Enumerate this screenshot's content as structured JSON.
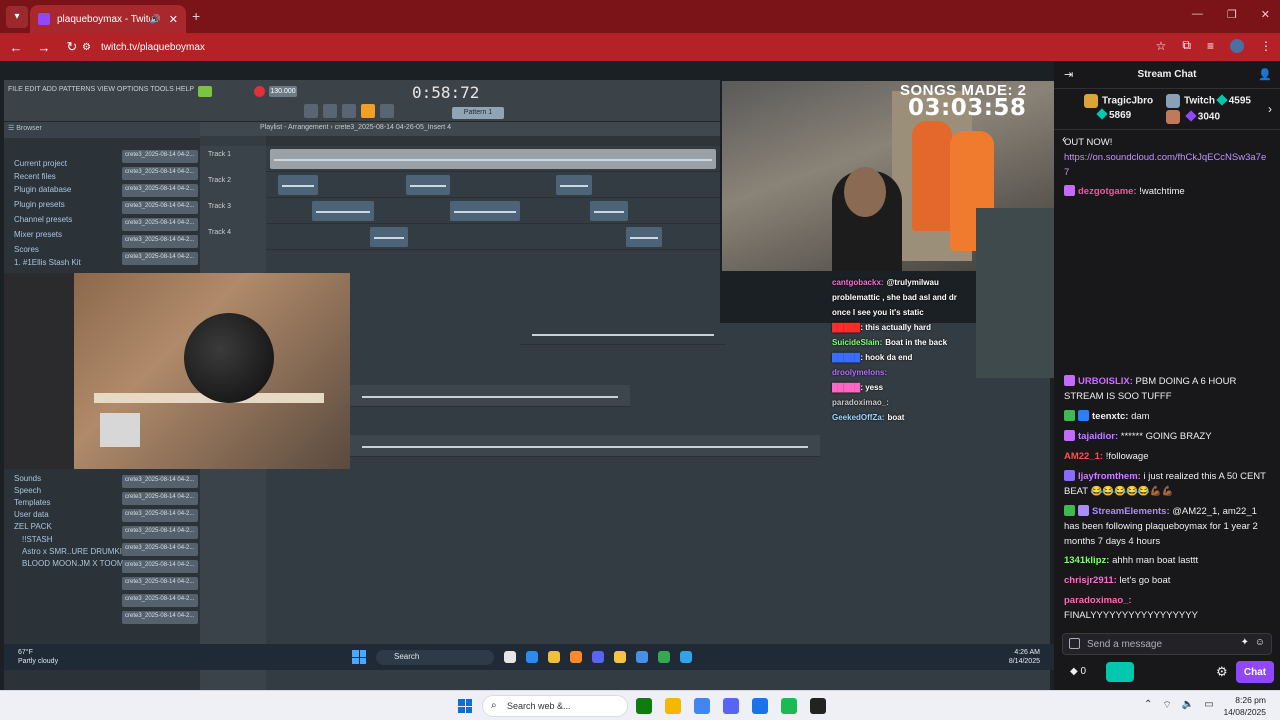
{
  "browser": {
    "tab_title": "plaqueboymax - Twitch",
    "new_tab": "+",
    "url": "twitch.tv/plaqueboymax"
  },
  "stream": {
    "songs_made": "SONGS MADE: 2",
    "timer": "03:03:58",
    "fl_menu": "FILE EDIT ADD PATTERNS VIEW OPTIONS TOOLS HELP",
    "fl_time": "0:58:72",
    "fl_bpm": "130.000",
    "fl_pattern": "Pattern 1",
    "playlist_title": "Playlist - Arrangement",
    "playlist_file": "crete3_2025-08-14 04-26-05_Insert 4",
    "tracks": [
      "Track 1",
      "Track 2",
      "Track 3",
      "Track 4"
    ],
    "browser_items": [
      "Current project",
      "Recent files",
      "Plugin database",
      "Plugin presets",
      "Channel presets",
      "Mixer presets",
      "Scores",
      "1. #1Ellis Stash Kit"
    ],
    "browser_items_lower": [
      "Sounds",
      "Speech",
      "Templates",
      "User data",
      "ZEL PACK",
      "!!STASH",
      "Astro x SMR..URE DRUMKIT",
      "BLOOD MOON.JM X TOOM"
    ],
    "file_entry": "crete3_2025-08-14 04-2...",
    "weather_temp": "67°F",
    "weather_desc": "Partly cloudy",
    "inner_search": "Search",
    "inner_time": "4:26 AM",
    "inner_date": "8/14/2025",
    "overlay_chat": [
      {
        "user": "cantgobackx:",
        "text": "@trulymilwau",
        "color": "#ff6ad5"
      },
      {
        "user": "",
        "text": "problemattic , she bad asl and dr",
        "color": "#fff"
      },
      {
        "user": "",
        "text": "once I see you it's static",
        "color": "#fff"
      },
      {
        "user": "",
        "text": ": this actually hard",
        "color": "#ff2b2b"
      },
      {
        "user": "SuicideSlain:",
        "text": "Boat in the back",
        "color": "#7cff7c"
      },
      {
        "user": "",
        "text": ": hook da end",
        "color": "#3b6bff"
      },
      {
        "user": "droolymelons:",
        "text": "",
        "color": "#b86bff"
      },
      {
        "user": "",
        "text": ": yess",
        "color": "#ff66c4"
      },
      {
        "user": "paradoximao_:",
        "text": "",
        "color": "#c8c8c8"
      },
      {
        "user": "GeekedOffZa:",
        "text": "boat",
        "color": "#9ad6ff"
      }
    ]
  },
  "chat": {
    "title": "Stream Chat",
    "gifts": [
      {
        "name": "TragicJbro",
        "count": "5869"
      },
      {
        "name": "Twitch",
        "count": "4595"
      },
      {
        "name": "",
        "count": "3040"
      }
    ],
    "messages": [
      {
        "user": "",
        "text": "OUT NOW!",
        "color": "#efeff1"
      },
      {
        "user": "",
        "link": "https://on.soundcloud.com/fhCkJqECcNSw3a7e7",
        "color": "#bf94ff"
      },
      {
        "user": "dezgotgame:",
        "text": "!watchtime",
        "color": "#ff4f9a"
      },
      {
        "user": "URBOISLIX:",
        "text": "PBM DOING A 6 HOUR STREAM IS SOO TUFFF",
        "color": "#d36bff"
      },
      {
        "user": "teenxtc:",
        "text": "dam",
        "color": "#efeff1"
      },
      {
        "user": "tajaidior:",
        "text": "****** GOING BRAZY",
        "color": "#c77dff"
      },
      {
        "user": "AM22_1:",
        "text": "!followage",
        "color": "#ff4d4d"
      },
      {
        "user": "ljayfromthem:",
        "text": "i just realized this A 50 CENT BEAT 😂😂😂😂😂💪🏾💪🏾",
        "color": "#d17bff"
      },
      {
        "user": "StreamElements:",
        "text": "@AM22_1, am22_1 has been following plaqueboymax for 1 year 2 months 7 days 4 hours",
        "color": "#a98cff"
      },
      {
        "user": "1341klipz:",
        "text": "ahhh man boat lasttt",
        "color": "#7cff6a"
      },
      {
        "user": "chrisjr2911:",
        "text": "let's go boat",
        "color": "#ff6bd0"
      },
      {
        "user": "paradoximao_:",
        "text": "FINALYYYYYYYYYYYYYYYYY",
        "color": "#ff69b4"
      }
    ],
    "input_placeholder": "Send a message",
    "points": "0",
    "chat_button": "Chat"
  },
  "taskbar": {
    "search_placeholder": "Search web &...",
    "time": "8:26 pm",
    "date": "14/08/2025"
  }
}
